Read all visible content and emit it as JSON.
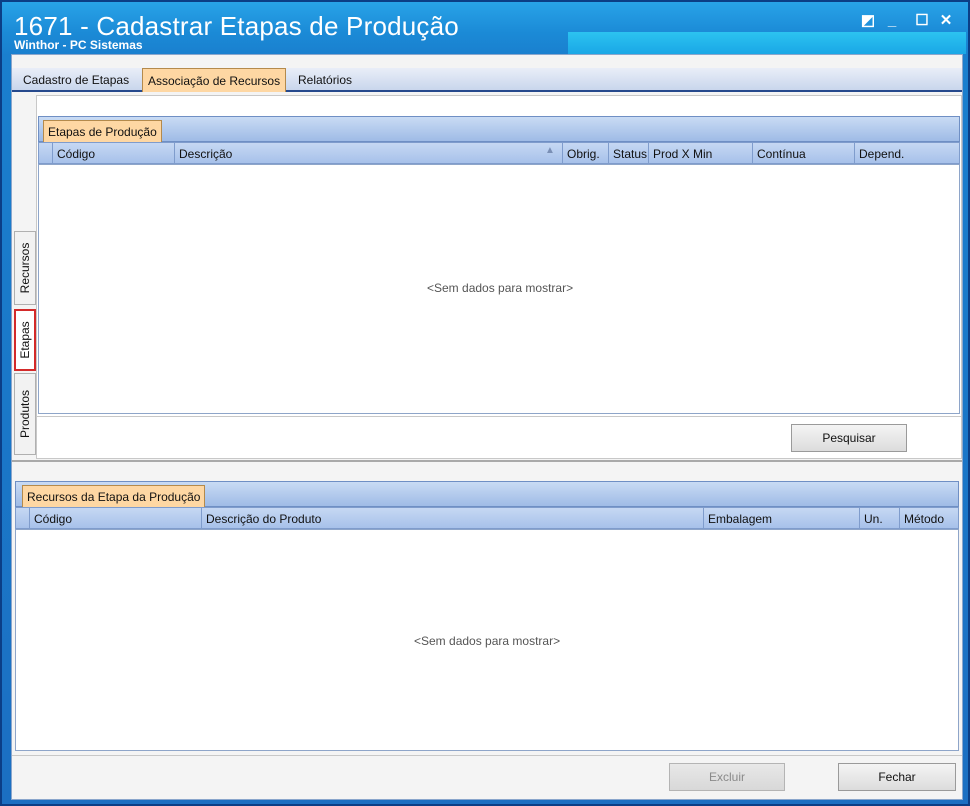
{
  "window": {
    "title": "1671 - Cadastrar Etapas de Produção",
    "subtitle": "Winthor - PC Sistemas",
    "controls": {
      "restore": "◩",
      "minimize": "_",
      "maximize": "☐",
      "close": "✕"
    }
  },
  "top_tabs": [
    "Cadastro de Etapas",
    "Associação de Recursos",
    "Relatórios"
  ],
  "top_tabs_active": "Associação de Recursos",
  "side_tabs": [
    "Recursos",
    "Etapas",
    "Produtos"
  ],
  "side_tabs_active": "Etapas",
  "etapas_grid": {
    "group_label": "Etapas de Produção",
    "columns": [
      "Código",
      "Descrição",
      "Obrig.",
      "Status",
      "Prod X Min",
      "Contínua",
      "Depend."
    ],
    "sort_indicator": "▲",
    "empty_text": "<Sem dados para mostrar>"
  },
  "pesquisar_button": "Pesquisar",
  "recursos_grid": {
    "group_label": "Recursos da Etapa da Produção",
    "columns": [
      "Código",
      "Descrição do Produto",
      "Embalagem",
      "Un.",
      "Método"
    ],
    "empty_text": "<Sem dados para mostrar>"
  },
  "footer": {
    "excluir_button": "Excluir",
    "fechar_button": "Fechar"
  },
  "colors": {
    "title_bar": "#1b8ad6",
    "active_tab": "#fed7a3",
    "grid_header": "#b6cdef",
    "selected_side_tab_border": "#d32a2a"
  }
}
